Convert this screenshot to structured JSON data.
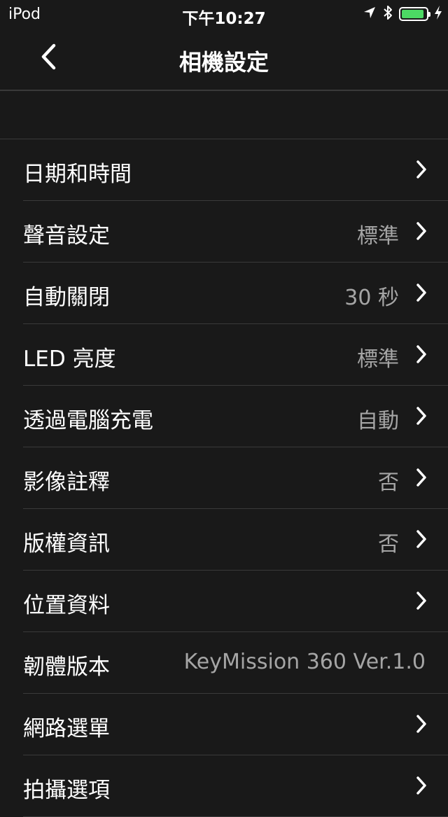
{
  "status_bar": {
    "device": "iPod",
    "time": "下午10:27",
    "battery_level": 0.9,
    "battery_color": "#4cd964",
    "icons": [
      "location-arrow-icon",
      "bluetooth-icon",
      "battery-icon",
      "charging-bolt-icon"
    ]
  },
  "nav": {
    "title": "相機設定",
    "back_icon": "chevron-left-icon"
  },
  "settings": [
    {
      "label": "日期和時間",
      "value": "",
      "chevron": true
    },
    {
      "label": "聲音設定",
      "value": "標準",
      "chevron": true
    },
    {
      "label": "自動關閉",
      "value": "30 秒",
      "chevron": true
    },
    {
      "label": "LED 亮度",
      "value": "標準",
      "chevron": true
    },
    {
      "label": "透過電腦充電",
      "value": "自動",
      "chevron": true
    },
    {
      "label": "影像註釋",
      "value": "否",
      "chevron": true
    },
    {
      "label": "版權資訊",
      "value": "否",
      "chevron": true
    },
    {
      "label": "位置資料",
      "value": "",
      "chevron": true
    },
    {
      "label": "韌體版本",
      "value": "KeyMission 360 Ver.1.0",
      "chevron": false
    },
    {
      "label": "網路選單",
      "value": "",
      "chevron": true
    },
    {
      "label": "拍攝選項",
      "value": "",
      "chevron": true
    }
  ]
}
